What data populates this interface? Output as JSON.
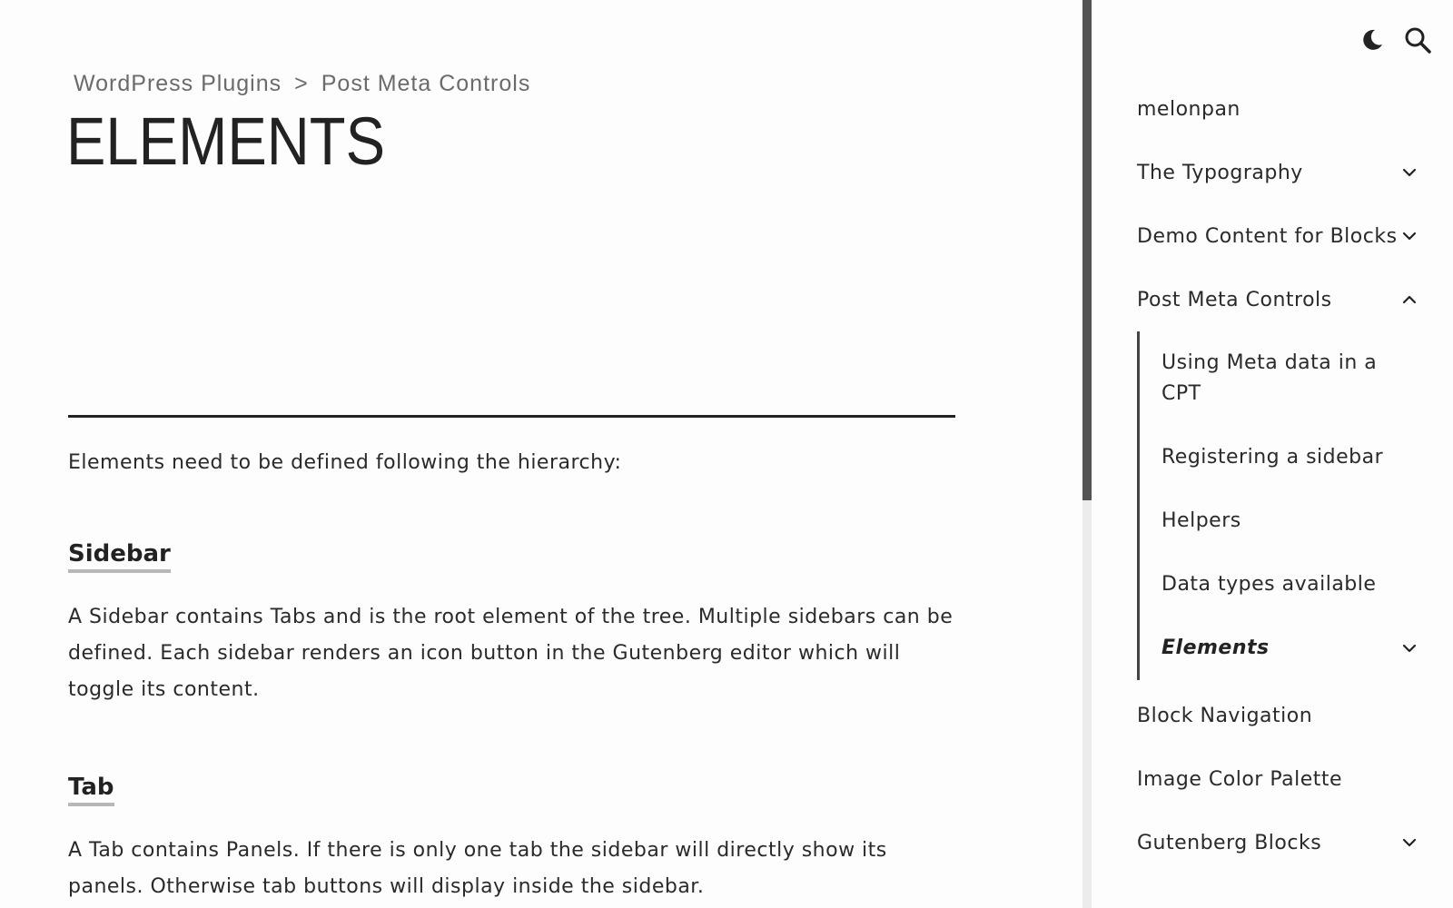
{
  "breadcrumb": {
    "items": [
      "WordPress Plugins",
      "Post Meta Controls"
    ],
    "separator": ">"
  },
  "page": {
    "title": "ELEMENTS",
    "intro": "Elements need to be defined following the hierarchy:",
    "sections": [
      {
        "heading": "Sidebar",
        "text": "A Sidebar contains Tabs and is the root element of the tree. Multiple sidebars can be defined. Each sidebar renders an icon button in the Gutenberg editor which will toggle its content."
      },
      {
        "heading": "Tab",
        "text": "A Tab contains Panels. If there is only one tab the sidebar will directly show its panels. Otherwise tab buttons will display inside the sidebar."
      }
    ]
  },
  "header_icons": {
    "theme_toggle": "moon-icon",
    "search": "search-icon"
  },
  "sidebar": {
    "items": [
      {
        "label": "melonpan"
      },
      {
        "label": "The Typography",
        "chevron": "down"
      },
      {
        "label": "Demo Content for Blocks",
        "chevron": "down"
      },
      {
        "label": "Post Meta Controls",
        "chevron": "up"
      },
      {
        "label": "Block Navigation"
      },
      {
        "label": "Image Color Palette"
      },
      {
        "label": "Gutenberg Blocks",
        "chevron": "down"
      }
    ],
    "sub_items": [
      {
        "label": "Using Meta data in a CPT"
      },
      {
        "label": "Registering a sidebar"
      },
      {
        "label": "Helpers"
      },
      {
        "label": "Data types available"
      },
      {
        "label": "Elements",
        "chevron": "down",
        "active": true
      }
    ]
  },
  "colors": {
    "text": "#222222",
    "muted": "#6b6b6b",
    "scroll_thumb": "#545454",
    "underline": "#b7b7b7"
  }
}
